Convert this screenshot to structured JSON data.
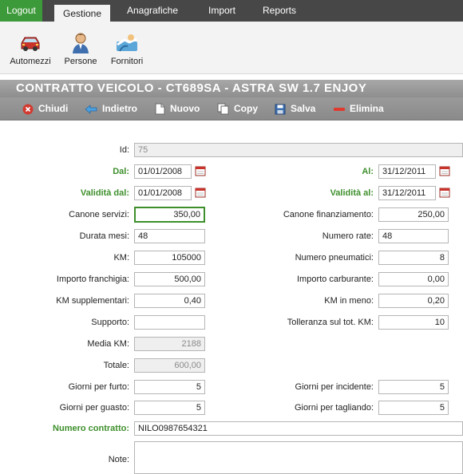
{
  "topnav": {
    "logout": "Logout",
    "tabs": [
      "Gestione",
      "Anagrafiche",
      "Import",
      "Reports"
    ]
  },
  "ribbon": {
    "automezzi": "Automezzi",
    "persone": "Persone",
    "fornitori": "Fornitori"
  },
  "title": "CONTRATTO VEICOLO - CT689SA - ASTRA SW 1.7 ENJOY",
  "toolbar": {
    "chiudi": "Chiudi",
    "indietro": "Indietro",
    "nuovo": "Nuovo",
    "copy": "Copy",
    "salva": "Salva",
    "elimina": "Elimina"
  },
  "form": {
    "id": {
      "label": "Id:",
      "value": "75"
    },
    "dal": {
      "label": "Dal:",
      "value": "01/01/2008"
    },
    "al": {
      "label": "Al:",
      "value": "31/12/2011"
    },
    "validita_dal": {
      "label": "Validità dal:",
      "value": "01/01/2008"
    },
    "validita_al": {
      "label": "Validità al:",
      "value": "31/12/2011"
    },
    "canone_servizi": {
      "label": "Canone servizi:",
      "value": "350,00"
    },
    "canone_finanziamento": {
      "label": "Canone finanziamento:",
      "value": "250,00"
    },
    "durata_mesi": {
      "label": "Durata mesi:",
      "value": "48"
    },
    "numero_rate": {
      "label": "Numero rate:",
      "value": "48"
    },
    "km": {
      "label": "KM:",
      "value": "105000"
    },
    "numero_pneumatici": {
      "label": "Numero pneumatici:",
      "value": "8"
    },
    "importo_franchigia": {
      "label": "Importo franchigia:",
      "value": "500,00"
    },
    "importo_carburante": {
      "label": "Importo carburante:",
      "value": "0,00"
    },
    "km_supplementari": {
      "label": "KM supplementari:",
      "value": "0,40"
    },
    "km_in_meno": {
      "label": "KM in meno:",
      "value": "0,20"
    },
    "supporto": {
      "label": "Supporto:",
      "value": ""
    },
    "tolleranza": {
      "label": "Tolleranza sul tot. KM:",
      "value": "10"
    },
    "media_km": {
      "label": "Media KM:",
      "value": "2188"
    },
    "totale": {
      "label": "Totale:",
      "value": "600,00"
    },
    "giorni_furto": {
      "label": "Giorni per furto:",
      "value": "5"
    },
    "giorni_incidente": {
      "label": "Giorni per incidente:",
      "value": "5"
    },
    "giorni_guasto": {
      "label": "Giorni per guasto:",
      "value": "5"
    },
    "giorni_tagliando": {
      "label": "Giorni per tagliando:",
      "value": "5"
    },
    "numero_contratto": {
      "label": "Numero contratto:",
      "value": "NILO0987654321"
    },
    "note": {
      "label": "Note:",
      "value": ""
    }
  },
  "colors": {
    "accent_green": "#3d8f2b",
    "topbar": "#474747",
    "toolbar": "#8e8e8e"
  }
}
